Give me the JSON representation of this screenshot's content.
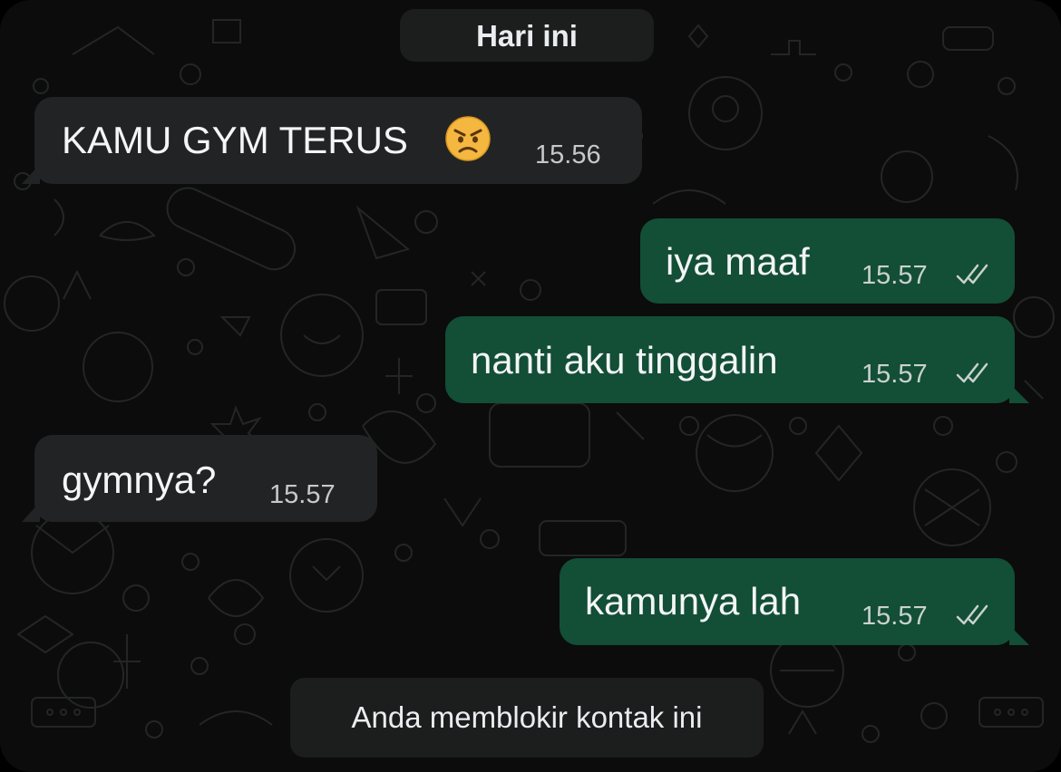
{
  "date_label": "Hari ini",
  "messages": [
    {
      "direction": "incoming",
      "text": "KAMU GYM TERUS",
      "emoji": "angry-face",
      "time": "15.56"
    },
    {
      "direction": "outgoing",
      "text": "iya maaf",
      "time": "15.57",
      "status": "read"
    },
    {
      "direction": "outgoing",
      "text": "nanti aku tinggalin",
      "time": "15.57",
      "status": "read"
    },
    {
      "direction": "incoming",
      "text": "gymnya?",
      "time": "15.57"
    },
    {
      "direction": "outgoing",
      "text": "kamunya lah",
      "time": "15.57",
      "status": "read"
    }
  ],
  "system_notice": "Anda memblokir kontak ini",
  "colors": {
    "background": "#0b0c0b",
    "incoming_bubble": "#222324",
    "outgoing_bubble": "#134e37",
    "pill": "#1c1d1d",
    "text": "#f3f5f6",
    "tick": "#c9d2cd"
  }
}
